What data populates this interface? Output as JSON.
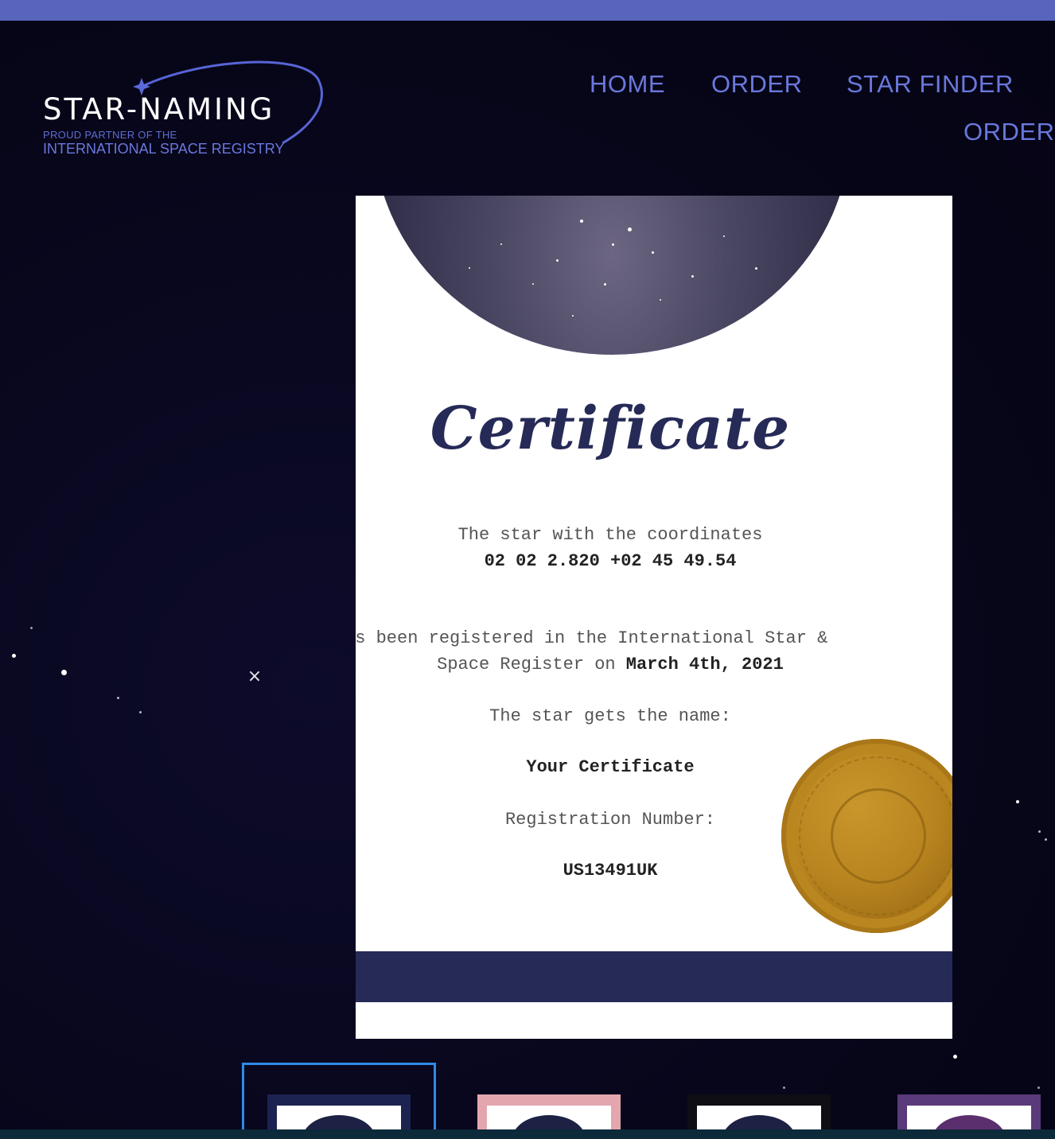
{
  "logo": {
    "name": "STAR-NAMING",
    "tagline_1": "PROUD PARTNER OF THE",
    "tagline_2": "INTERNATIONAL SPACE REGISTRY"
  },
  "nav": {
    "home": "HOME",
    "order": "ORDER",
    "star_finder": "STAR FINDER",
    "order_2": "ORDER"
  },
  "close_label": "×",
  "certificate": {
    "title": "Certificate",
    "line_1": "The star with the coordinates",
    "coordinates": "02 02 2.820 +02 45 49.54",
    "line_2": "as been registered in the International Star &",
    "line_3_prefix": "Space Register on ",
    "date": "March 4th, 2021",
    "line_4": "The star gets the name:",
    "star_name": "Your Certificate",
    "reg_label": "Registration Number:",
    "reg_number": "US13491UK"
  },
  "colors": {
    "top_bar": "#5865bd",
    "nav_text": "#6a78dc",
    "background": "#07061a",
    "certificate_navy": "#262a57",
    "seal_gold": "#b8841f",
    "thumbnail_selected": "#2f8ae6"
  },
  "thumbnails": [
    {
      "frame_color": "#1c2350",
      "selected": true
    },
    {
      "frame_color": "#e3a6ae",
      "selected": false
    },
    {
      "frame_color": "#0e0e14",
      "selected": false
    },
    {
      "frame_color": "#5a3a7a",
      "selected": false
    }
  ]
}
